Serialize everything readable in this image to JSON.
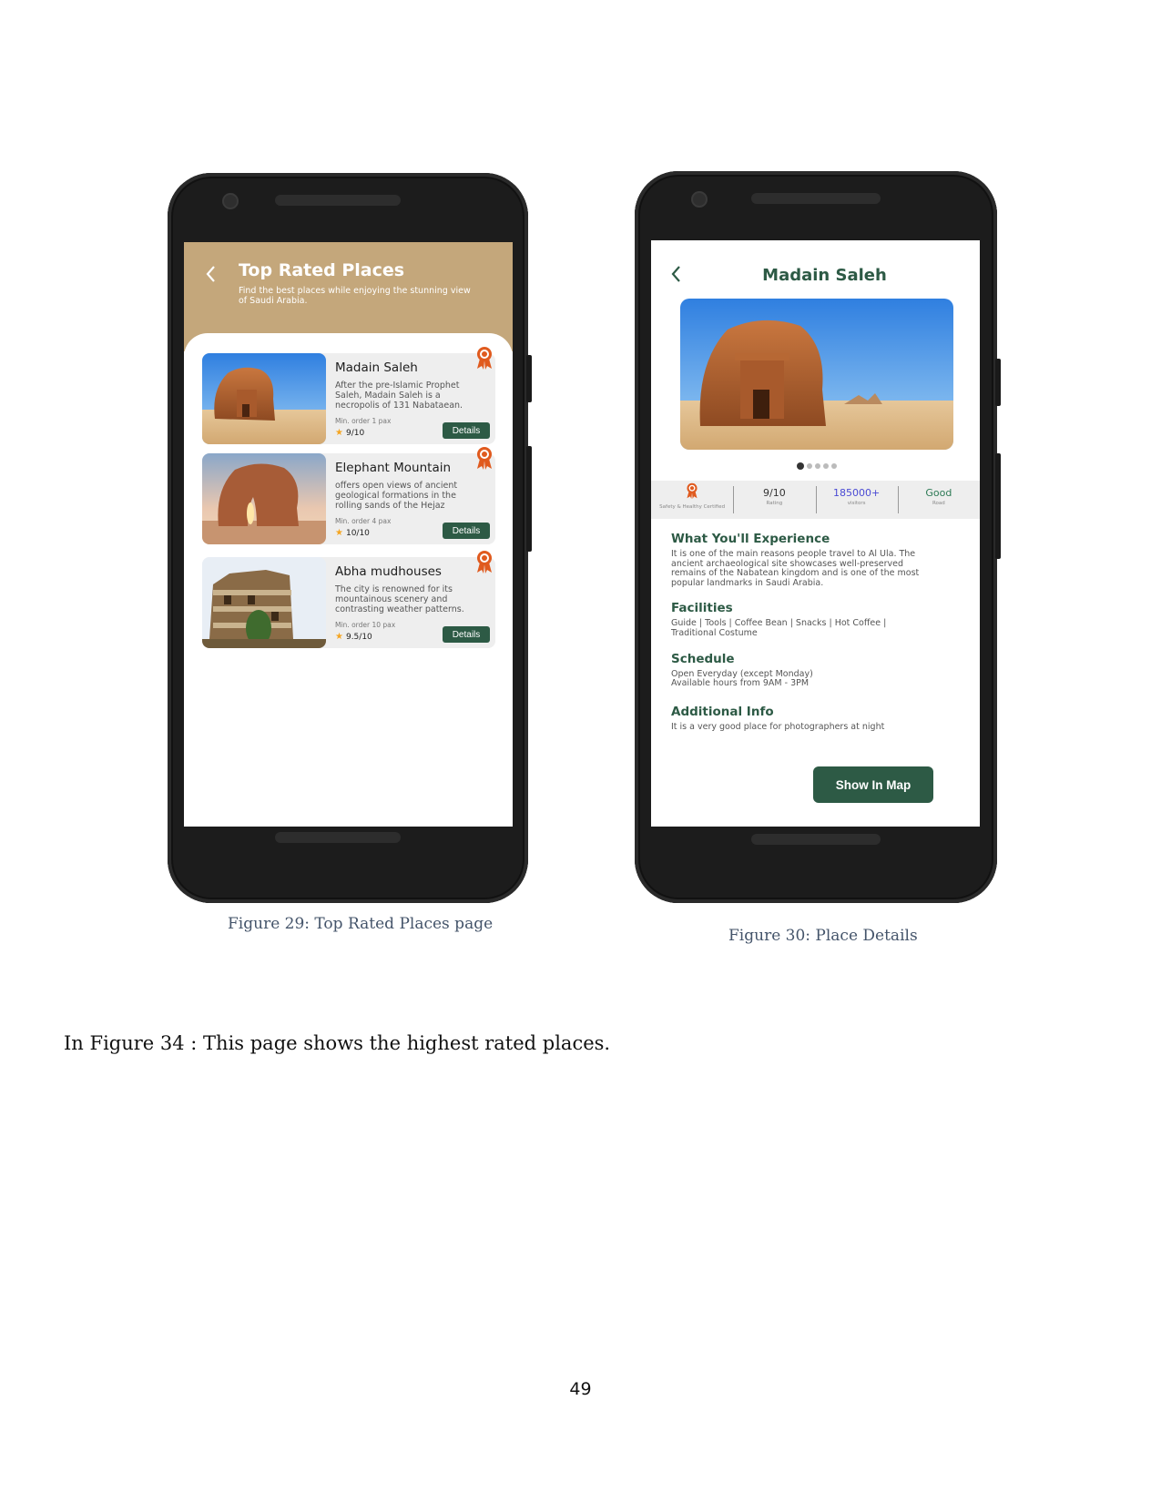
{
  "phone1": {
    "header": {
      "back_icon": "chevron-left-icon",
      "title": "Top Rated Places",
      "subtitle": "Find the best places while enjoying the stunning view of Saudi Arabia."
    },
    "cards": [
      {
        "name": "Madain Saleh",
        "description": "After the pre-Islamic Prophet Saleh, Madain Saleh is a necropolis of 131 Nabataean.",
        "min_order": "Min. order 1 pax",
        "rating": "9/10",
        "details": "Details",
        "badge_icon": "award-ribbon-icon"
      },
      {
        "name": "Elephant Mountain",
        "description": "offers open views of ancient geological formations in the rolling sands of the Hejaz",
        "min_order": "Min. order 4 pax",
        "rating": "10/10",
        "details": "Details",
        "badge_icon": "award-ribbon-icon"
      },
      {
        "name": "Abha mudhouses",
        "description": "The city is renowned for its mountainous scenery and contrasting weather patterns.",
        "min_order": "Min. order 10 pax",
        "rating": "9.5/10",
        "details": "Details",
        "badge_icon": "award-ribbon-icon"
      }
    ]
  },
  "phone2": {
    "back_icon": "chevron-left-icon",
    "title": "Madain Saleh",
    "carousel": {
      "count": 5,
      "active": 1
    },
    "stats": [
      {
        "value": "",
        "label": "Safety & Healthy Certified",
        "icon": "award-ribbon-icon"
      },
      {
        "value": "9/10",
        "label": "Rating"
      },
      {
        "value": "185000+",
        "label": "visitors"
      },
      {
        "value": "Good",
        "label": "Road"
      }
    ],
    "experience": {
      "heading": "What You'll Experience",
      "text": "It is one of the main reasons people travel to Al Ula. The ancient archaeological site showcases well-preserved remains of the Nabatean kingdom and is one of the most popular landmarks in Saudi Arabia."
    },
    "facilities": {
      "heading": "Facilities",
      "text": "Guide | Tools | Coffee Bean | Snacks | Hot Coffee | Traditional Costume"
    },
    "schedule": {
      "heading": "Schedule",
      "line1": "Open Everyday (except Monday)",
      "line2": "Available hours from 9AM - 3PM"
    },
    "additional": {
      "heading": "Additional Info",
      "text": "It is a very good place for photographers at night"
    },
    "map_button": "Show In Map"
  },
  "captions": {
    "fig29": "Figure 29: Top Rated Places page",
    "fig30": "Figure 30: Place Details"
  },
  "body_text": "In Figure 34 : This page shows the highest rated places.",
  "page_number": "49",
  "colors": {
    "header_tan": "#c4a77b",
    "brand_green": "#2d5a45",
    "badge_orange": "#e05a1e",
    "star": "#f5a623"
  }
}
